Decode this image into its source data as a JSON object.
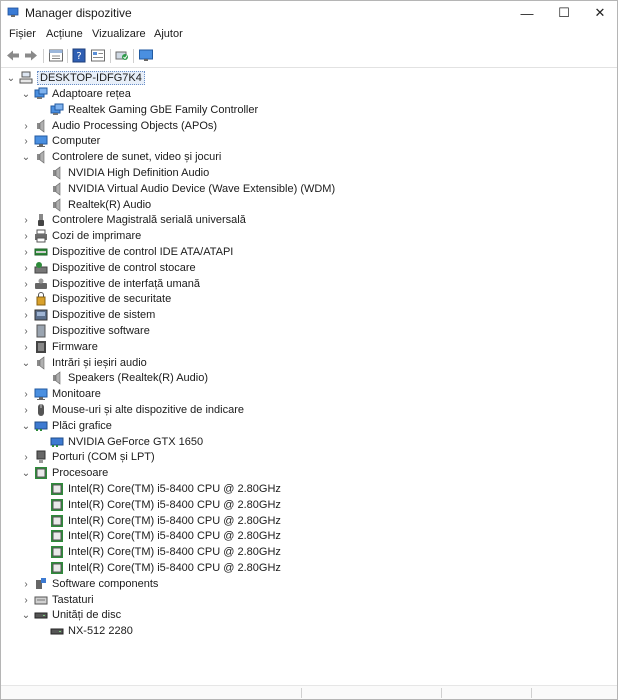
{
  "window": {
    "title": "Manager dispozitive",
    "minimize": "—",
    "maximize": "☐",
    "close": "✕"
  },
  "menu": [
    "Fișier",
    "Acțiune",
    "Vizualizare",
    "Ajutor"
  ],
  "tree": {
    "root": "DESKTOP-IDFG7K4",
    "rows": [
      {
        "label": "Adaptoare rețea",
        "level": 1,
        "state": "expanded",
        "icon": "network-icon"
      },
      {
        "label": "Realtek Gaming GbE Family Controller",
        "level": 2,
        "state": "leaf",
        "icon": "network-icon"
      },
      {
        "label": "Audio Processing Objects (APOs)",
        "level": 1,
        "state": "collapsed",
        "icon": "speaker-icon"
      },
      {
        "label": "Computer",
        "level": 1,
        "state": "collapsed",
        "icon": "monitor-icon"
      },
      {
        "label": "Controlere de sunet, video și jocuri",
        "level": 1,
        "state": "expanded",
        "icon": "speaker-icon"
      },
      {
        "label": "NVIDIA High Definition Audio",
        "level": 2,
        "state": "leaf",
        "icon": "speaker-icon"
      },
      {
        "label": "NVIDIA Virtual Audio Device (Wave Extensible) (WDM)",
        "level": 2,
        "state": "leaf",
        "icon": "speaker-icon"
      },
      {
        "label": "Realtek(R) Audio",
        "level": 2,
        "state": "leaf",
        "icon": "speaker-icon"
      },
      {
        "label": "Controlere Magistrală serială universală",
        "level": 1,
        "state": "collapsed",
        "icon": "usb-icon"
      },
      {
        "label": "Cozi de imprimare",
        "level": 1,
        "state": "collapsed",
        "icon": "printer-icon"
      },
      {
        "label": "Dispozitive de control IDE ATA/ATAPI",
        "level": 1,
        "state": "collapsed",
        "icon": "ide-icon"
      },
      {
        "label": "Dispozitive de control stocare",
        "level": 1,
        "state": "collapsed",
        "icon": "storage-controller-icon"
      },
      {
        "label": "Dispozitive de interfață umană",
        "level": 1,
        "state": "collapsed",
        "icon": "hid-icon"
      },
      {
        "label": "Dispozitive de securitate",
        "level": 1,
        "state": "collapsed",
        "icon": "security-icon"
      },
      {
        "label": "Dispozitive de sistem",
        "level": 1,
        "state": "collapsed",
        "icon": "system-icon"
      },
      {
        "label": "Dispozitive software",
        "level": 1,
        "state": "collapsed",
        "icon": "software-device-icon"
      },
      {
        "label": "Firmware",
        "level": 1,
        "state": "collapsed",
        "icon": "firmware-icon"
      },
      {
        "label": "Intrări și ieșiri audio",
        "level": 1,
        "state": "expanded",
        "icon": "speaker-icon"
      },
      {
        "label": "Speakers (Realtek(R) Audio)",
        "level": 2,
        "state": "leaf",
        "icon": "speaker-icon"
      },
      {
        "label": "Monitoare",
        "level": 1,
        "state": "collapsed",
        "icon": "monitor-icon"
      },
      {
        "label": "Mouse-uri și alte dispozitive de indicare",
        "level": 1,
        "state": "collapsed",
        "icon": "mouse-icon"
      },
      {
        "label": "Plăci grafice",
        "level": 1,
        "state": "expanded",
        "icon": "display-adapter-icon"
      },
      {
        "label": "NVIDIA GeForce GTX 1650",
        "level": 2,
        "state": "leaf",
        "icon": "display-adapter-icon"
      },
      {
        "label": "Porturi (COM și LPT)",
        "level": 1,
        "state": "collapsed",
        "icon": "port-icon"
      },
      {
        "label": "Procesoare",
        "level": 1,
        "state": "expanded",
        "icon": "cpu-icon"
      },
      {
        "label": "Intel(R) Core(TM) i5-8400 CPU @ 2.80GHz",
        "level": 2,
        "state": "leaf",
        "icon": "cpu-icon"
      },
      {
        "label": "Intel(R) Core(TM) i5-8400 CPU @ 2.80GHz",
        "level": 2,
        "state": "leaf",
        "icon": "cpu-icon"
      },
      {
        "label": "Intel(R) Core(TM) i5-8400 CPU @ 2.80GHz",
        "level": 2,
        "state": "leaf",
        "icon": "cpu-icon"
      },
      {
        "label": "Intel(R) Core(TM) i5-8400 CPU @ 2.80GHz",
        "level": 2,
        "state": "leaf",
        "icon": "cpu-icon"
      },
      {
        "label": "Intel(R) Core(TM) i5-8400 CPU @ 2.80GHz",
        "level": 2,
        "state": "leaf",
        "icon": "cpu-icon"
      },
      {
        "label": "Intel(R) Core(TM) i5-8400 CPU @ 2.80GHz",
        "level": 2,
        "state": "leaf",
        "icon": "cpu-icon"
      },
      {
        "label": "Software components",
        "level": 1,
        "state": "collapsed",
        "icon": "software-component-icon"
      },
      {
        "label": "Tastaturi",
        "level": 1,
        "state": "collapsed",
        "icon": "keyboard-icon"
      },
      {
        "label": "Unități de disc",
        "level": 1,
        "state": "expanded",
        "icon": "disk-icon"
      },
      {
        "label": "NX-512 2280",
        "level": 2,
        "state": "leaf",
        "icon": "disk-icon"
      }
    ]
  },
  "colors": {
    "accent": "#1e6fd0",
    "selection": "#e8eff9",
    "cpu_green": "#2e8b3a"
  }
}
